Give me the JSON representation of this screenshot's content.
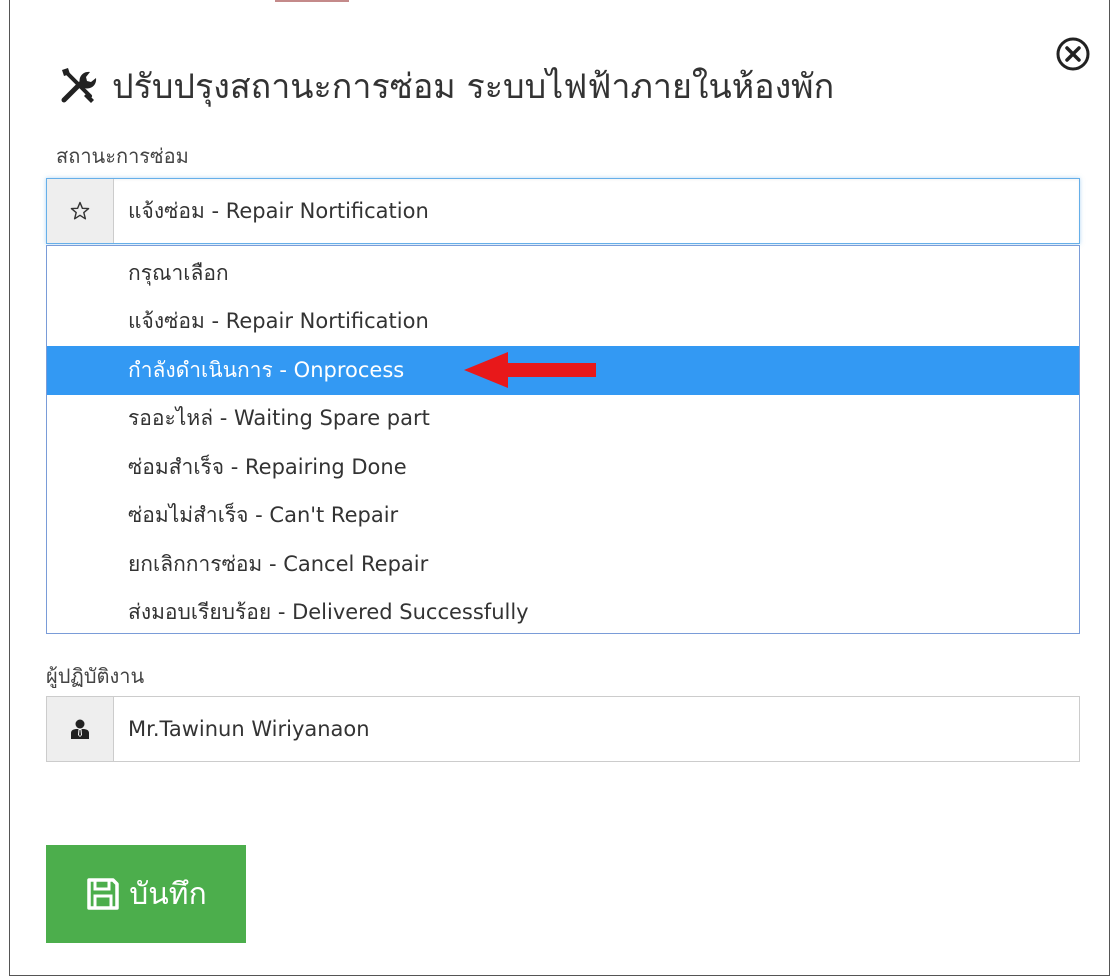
{
  "dialog": {
    "title": "ปรับปรุงสถานะการซ่อม ระบบไฟฟ้าภายในห้องพัก",
    "title_icon": "tools-icon",
    "close_icon": "close-circle-icon"
  },
  "status_field": {
    "label": "สถานะการซ่อม",
    "icon": "star-icon",
    "selected_value": "แจ้งซ่อม - Repair Nortification",
    "options": [
      "กรุณาเลือก",
      "แจ้งซ่อม - Repair Nortification",
      "กำลังดำเนินการ - Onprocess",
      "รออะไหล่ - Waiting Spare part",
      "ซ่อมสำเร็จ - Repairing Done",
      "ซ่อมไม่สำเร็จ - Can't Repair",
      "ยกเลิกการซ่อม - Cancel Repair",
      "ส่งมอบเรียบร้อย - Delivered Successfully"
    ],
    "highlighted_index": 2
  },
  "operator_field": {
    "label": "ผู้ปฏิบัติงาน",
    "icon": "user-suit-icon",
    "value": "Mr.Tawinun Wiriyanaon"
  },
  "save_button": {
    "label": "บันทึก",
    "icon": "floppy-disk-icon"
  },
  "colors": {
    "highlight": "#3399f3",
    "save": "#4cae4c",
    "arrow": "#e8181a",
    "focus_border": "#66afe9"
  }
}
